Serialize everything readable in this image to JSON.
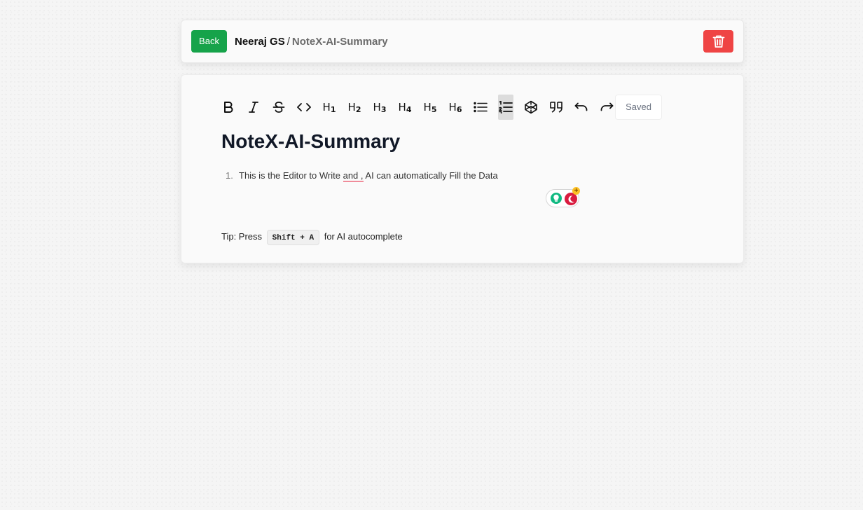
{
  "header": {
    "back_label": "Back",
    "user_name": "Neeraj GS",
    "separator": "/",
    "document_name": "NoteX-AI-Summary",
    "delete_icon": "trash-icon",
    "colors": {
      "back": "#16a34a",
      "delete": "#ef4444"
    }
  },
  "toolbar": {
    "buttons": [
      {
        "icon": "bold-icon"
      },
      {
        "icon": "italic-icon"
      },
      {
        "icon": "strikethrough-icon"
      },
      {
        "icon": "code-icon"
      },
      {
        "icon": "heading-1-icon",
        "label": "H",
        "level": "1"
      },
      {
        "icon": "heading-2-icon",
        "label": "H",
        "level": "2"
      },
      {
        "icon": "heading-3-icon",
        "label": "H",
        "level": "3"
      },
      {
        "icon": "heading-4-icon",
        "label": "H",
        "level": "4"
      },
      {
        "icon": "heading-5-icon",
        "label": "H",
        "level": "5"
      },
      {
        "icon": "heading-6-icon",
        "label": "H",
        "level": "6"
      },
      {
        "icon": "bullet-list-icon"
      },
      {
        "icon": "ordered-list-icon",
        "active": true
      },
      {
        "icon": "code-block-icon"
      },
      {
        "icon": "blockquote-icon"
      },
      {
        "icon": "undo-icon"
      },
      {
        "icon": "redo-icon"
      }
    ],
    "status": "Saved"
  },
  "editor": {
    "title": "NoteX-AI-Summary",
    "list_items": [
      {
        "number": "1.",
        "text_before": "This is the Editor to Write ",
        "misspelled": "and ,",
        "text_after": " AI can automatically Fill the Data"
      }
    ]
  },
  "extension_widget": {
    "icons": [
      "bulb-icon",
      "moon-icon",
      "plus-badge-icon"
    ],
    "badge": "+"
  },
  "tip": {
    "prefix": "Tip: Press",
    "shortcut": "Shift + A",
    "suffix": "for AI autocomplete"
  }
}
